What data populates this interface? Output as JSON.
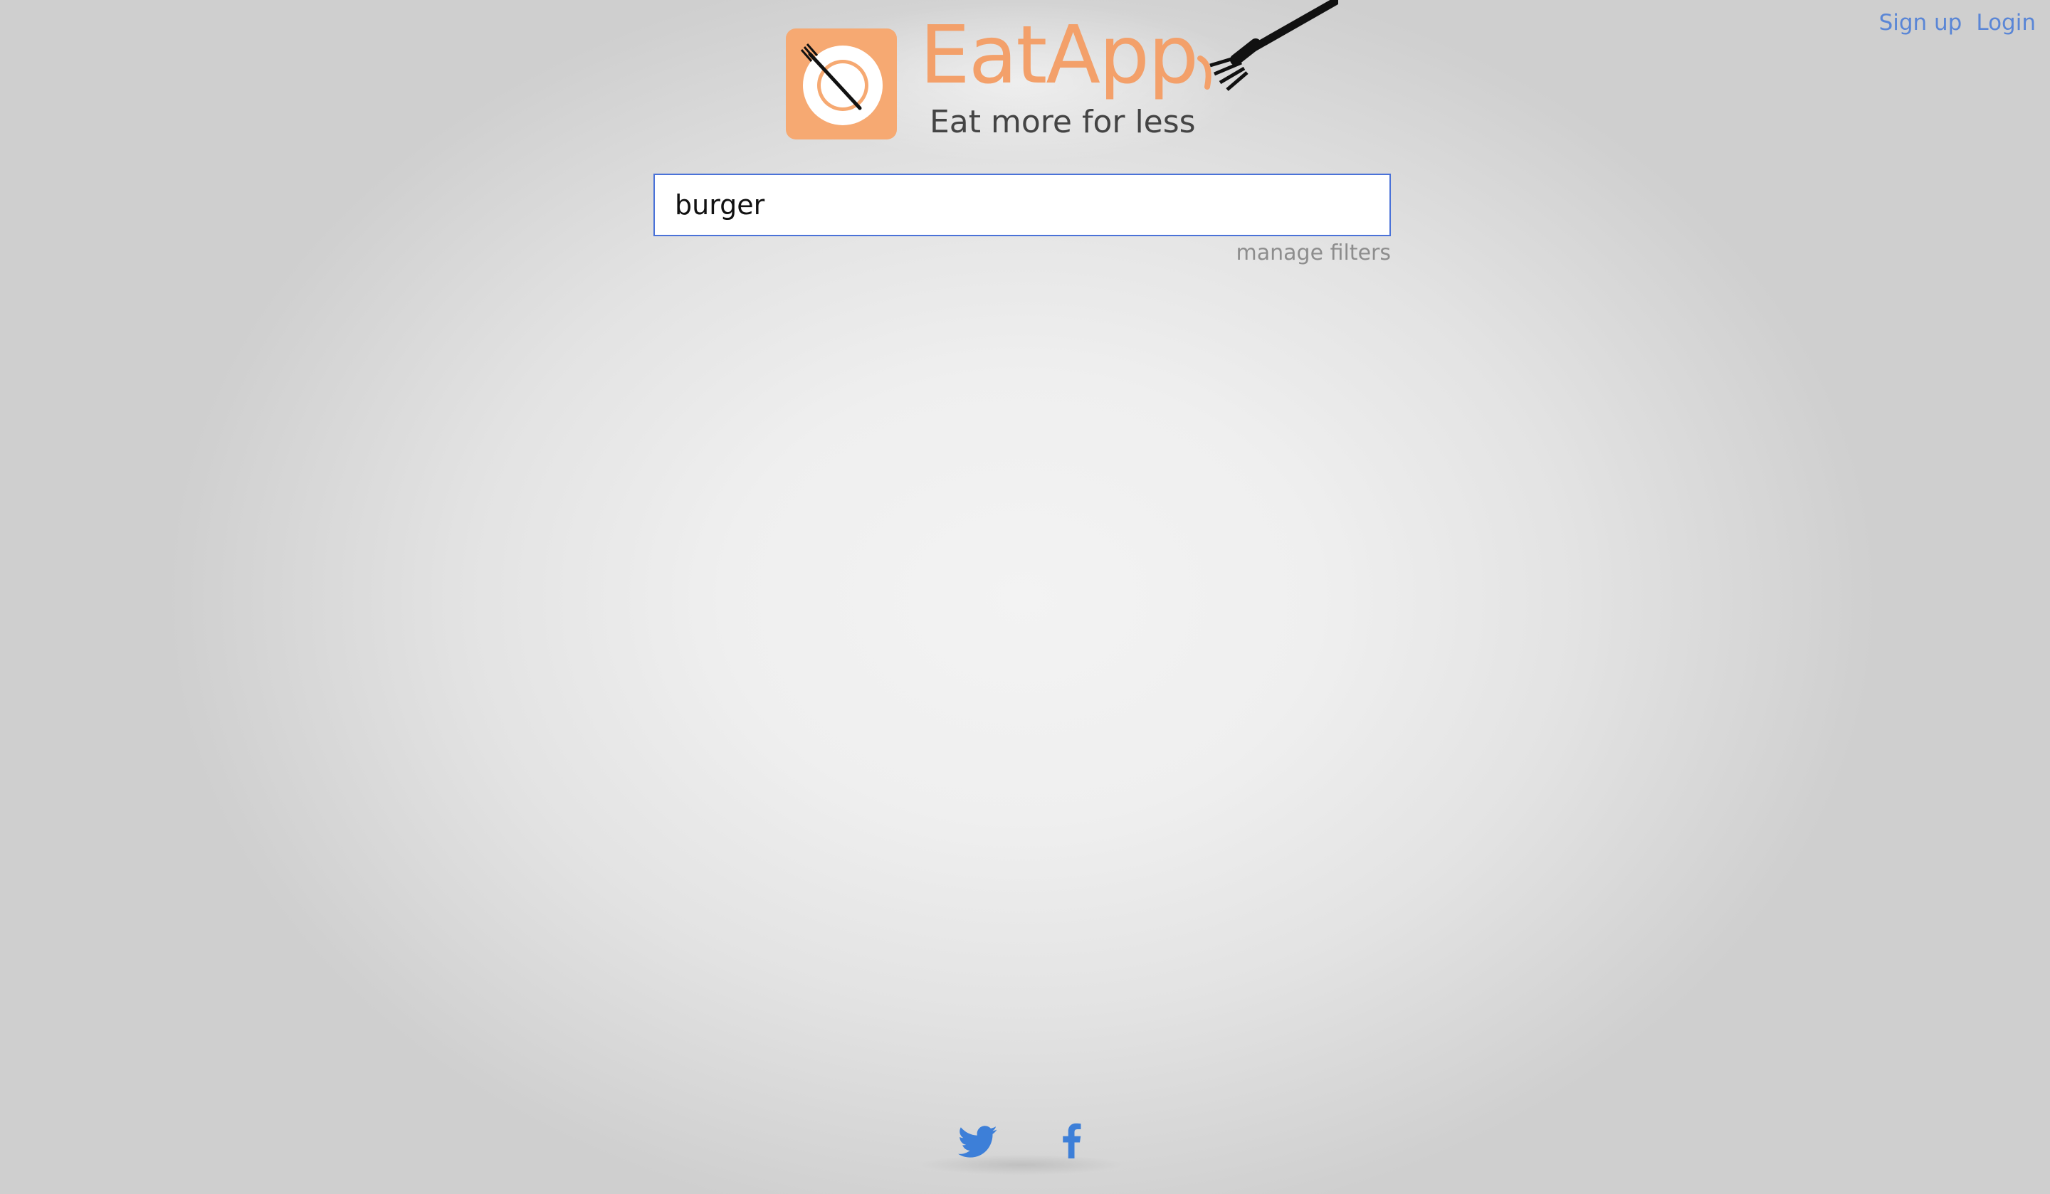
{
  "header": {
    "signup_label": "Sign up",
    "login_label": "Login"
  },
  "logo": {
    "title": "EatApp",
    "tagline": "Eat more for less",
    "icons": [
      "plate-icon",
      "fork-icon"
    ]
  },
  "search": {
    "value": "burger",
    "placeholder": ""
  },
  "filters": {
    "manage_label": "manage filters"
  },
  "footer": {
    "icons": [
      "twitter-icon",
      "facebook-icon"
    ]
  },
  "colors": {
    "brand_orange": "#f3a06a",
    "link_blue": "#5a86d6",
    "input_border": "#4a72d8",
    "icon_blue": "#3d7fd8"
  }
}
